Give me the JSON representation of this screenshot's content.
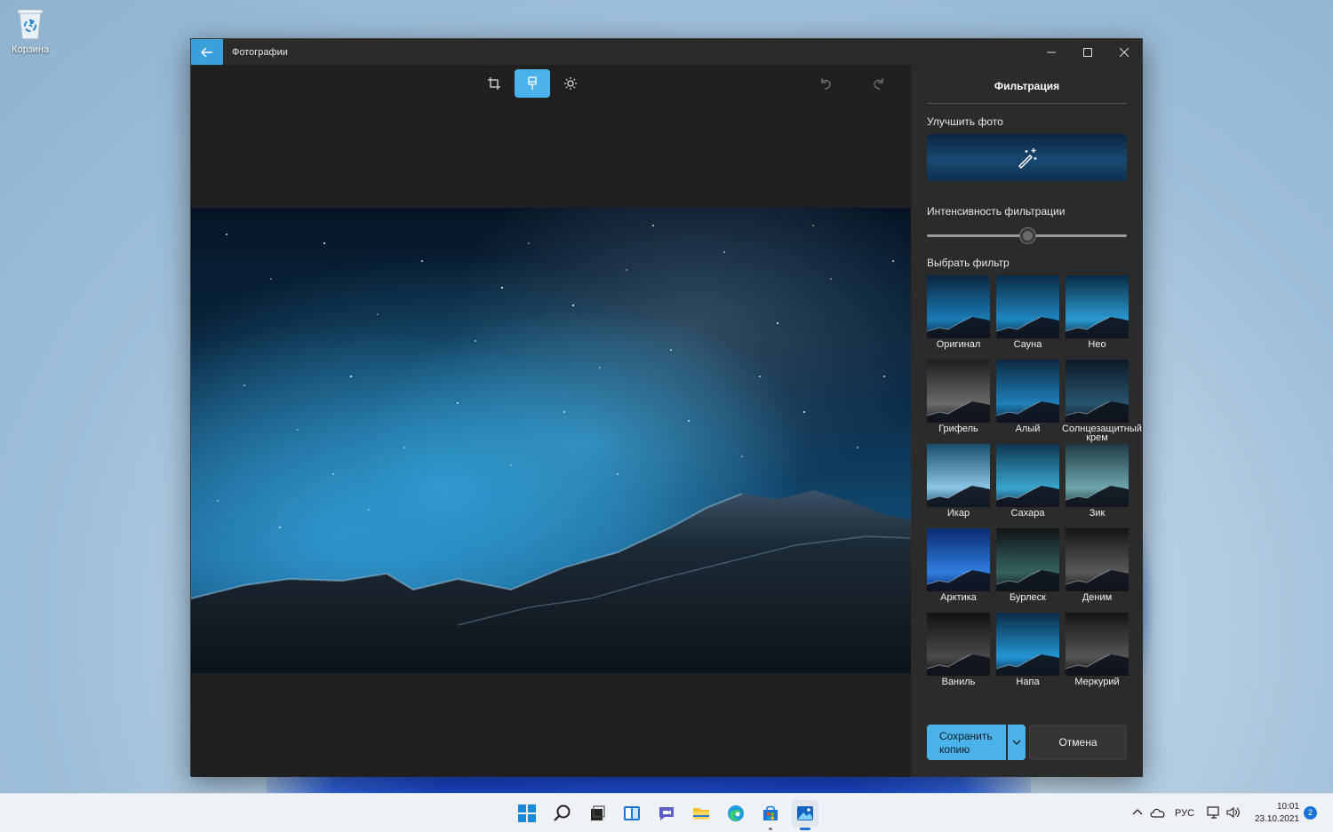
{
  "desktop": {
    "recycle_bin_label": "Корзина"
  },
  "window": {
    "title": "Фотографии"
  },
  "editor": {
    "tools": [
      "crop-icon",
      "filter-brush-icon",
      "brightness-icon"
    ],
    "active_tool": "filter-brush-icon"
  },
  "panel": {
    "title": "Фильтрация",
    "enhance_label": "Улучшить фото",
    "intensity_label": "Интенсивность фильтрации",
    "intensity_value": 0.5,
    "choose_filter_label": "Выбрать фильтр",
    "filters": [
      {
        "name": "Оригинал"
      },
      {
        "name": "Сауна"
      },
      {
        "name": "Нео"
      },
      {
        "name": "Грифель"
      },
      {
        "name": "Алый"
      },
      {
        "name": "Солнцезащитный крем"
      },
      {
        "name": "Икар"
      },
      {
        "name": "Сахара"
      },
      {
        "name": "Зик"
      },
      {
        "name": "Арктика"
      },
      {
        "name": "Бурлеск"
      },
      {
        "name": "Деним"
      },
      {
        "name": "Ваниль"
      },
      {
        "name": "Напа"
      },
      {
        "name": "Меркурий"
      }
    ],
    "save_label": "Сохранить копию",
    "cancel_label": "Отмена"
  },
  "taskbar": {
    "language": "РУС",
    "time": "10:01",
    "date": "23.10.2021",
    "notification_count": "2"
  },
  "colors": {
    "accent": "#4cb2ea",
    "window_bg": "#202020",
    "panel_bg": "#2b2b2b"
  }
}
